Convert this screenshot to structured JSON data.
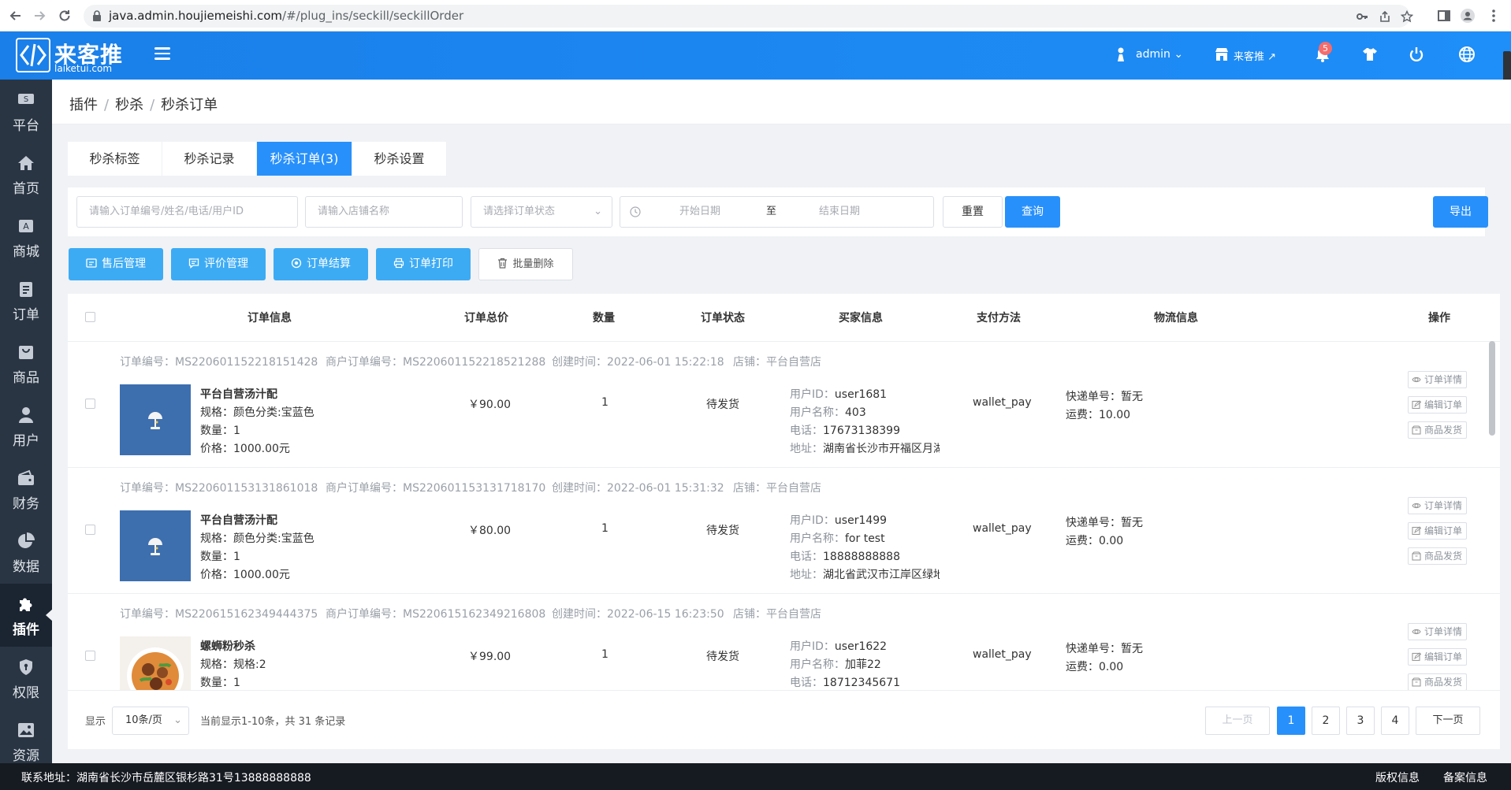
{
  "browser": {
    "url_host": "java.admin.houjiemeishi.com",
    "url_path": "/#/plug_ins/seckill/seckillOrder"
  },
  "header": {
    "logo_cn": "来客推",
    "logo_en": "laiketui.com",
    "user": "admin",
    "store_link": "来客推",
    "notification_count": "5"
  },
  "sidebar": {
    "items": [
      {
        "label": "平台",
        "icon": "platform-icon"
      },
      {
        "label": "首页",
        "icon": "home-icon"
      },
      {
        "label": "商城",
        "icon": "mall-icon"
      },
      {
        "label": "订单",
        "icon": "order-icon"
      },
      {
        "label": "商品",
        "icon": "goods-icon"
      },
      {
        "label": "用户",
        "icon": "user-icon"
      },
      {
        "label": "财务",
        "icon": "wallet-icon"
      },
      {
        "label": "数据",
        "icon": "pie-chart-icon"
      },
      {
        "label": "插件",
        "icon": "puzzle-icon",
        "active": true
      },
      {
        "label": "权限",
        "icon": "shield-icon"
      },
      {
        "label": "资源",
        "icon": "image-icon"
      }
    ]
  },
  "breadcrumb": {
    "items": [
      "插件",
      "秒杀",
      "秒杀订单"
    ]
  },
  "tabs": [
    {
      "label": "秒杀标签"
    },
    {
      "label": "秒杀记录"
    },
    {
      "label": "秒杀订单(3)",
      "active": true
    },
    {
      "label": "秒杀设置"
    }
  ],
  "filter": {
    "order_search_placeholder": "请输入订单编号/姓名/电话/用户ID",
    "store_placeholder": "请输入店铺名称",
    "status_placeholder": "请选择订单状态",
    "start_date_placeholder": "开始日期",
    "date_separator": "至",
    "end_date_placeholder": "结束日期",
    "reset_label": "重置",
    "query_label": "查询",
    "export_label": "导出"
  },
  "actions": {
    "after_sale": "售后管理",
    "reviews": "评价管理",
    "settlement": "订单结算",
    "print": "订单打印",
    "batch_delete": "批量删除"
  },
  "table": {
    "headers": {
      "order_info": "订单信息",
      "total": "订单总价",
      "quantity": "数量",
      "status": "订单状态",
      "buyer": "买家信息",
      "payment": "支付方法",
      "logistics": "物流信息",
      "operation": "操作"
    },
    "op_labels": {
      "detail": "订单详情",
      "edit": "编辑订单",
      "ship": "商品发货"
    },
    "orders": [
      {
        "order_no": "订单编号：MS220601152218151428",
        "merchant_no": "商户订单编号：MS220601152218521288",
        "created": "创建时间：2022-06-01 15:22:18",
        "store": "店铺：平台自营店",
        "product_name": "平台自营汤汁配",
        "spec": "规格：颜色分类:宝蓝色",
        "qty_line": "数量：1",
        "price_line": "价格：1000.00元",
        "total": "￥90.00",
        "quantity": "1",
        "status": "待发货",
        "buyer_id_label": "用户ID：",
        "buyer_id": "user1681",
        "buyer_name_label": "用户名称：",
        "buyer_name": "403",
        "buyer_phone_label": "电话：",
        "buyer_phone": "17673138399",
        "buyer_addr_label": "地址：",
        "buyer_addr": "湖南省长沙市开福区月湖",
        "payment": "wallet_pay",
        "express": "快递单号：暂无",
        "freight": "运费：10.00",
        "image": "product-icon-lamp"
      },
      {
        "order_no": "订单编号：MS220601153131861018",
        "merchant_no": "商户订单编号：MS220601153131718170",
        "created": "创建时间：2022-06-01 15:31:32",
        "store": "店铺：平台自营店",
        "product_name": "平台自营汤汁配",
        "spec": "规格：颜色分类:宝蓝色",
        "qty_line": "数量：1",
        "price_line": "价格：1000.00元",
        "total": "￥80.00",
        "quantity": "1",
        "status": "待发货",
        "buyer_id_label": "用户ID：",
        "buyer_id": "user1499",
        "buyer_name_label": "用户名称：",
        "buyer_name": "for test",
        "buyer_phone_label": "电话：",
        "buyer_phone": "18888888888",
        "buyer_addr_label": "地址：",
        "buyer_addr": "湖北省武汉市江岸区绿地",
        "payment": "wallet_pay",
        "express": "快递单号：暂无",
        "freight": "运费：0.00",
        "image": "product-icon-lamp"
      },
      {
        "order_no": "订单编号：MS220615162349444375",
        "merchant_no": "商户订单编号：MS220615162349216808",
        "created": "创建时间：2022-06-15 16:23:50",
        "store": "店铺：平台自营店",
        "product_name": "螺蛳粉秒杀",
        "spec": "规格：规格:2",
        "qty_line": "数量：1",
        "price_line": "",
        "total": "￥99.00",
        "quantity": "1",
        "status": "待发货",
        "buyer_id_label": "用户ID：",
        "buyer_id": "user1622",
        "buyer_name_label": "用户名称：",
        "buyer_name": "加菲22",
        "buyer_phone_label": "电话：",
        "buyer_phone": "18712345671",
        "buyer_addr_label": "",
        "buyer_addr": "",
        "payment": "wallet_pay",
        "express": "快递单号：暂无",
        "freight": "运费：0.00",
        "image": "product-photo-food"
      }
    ]
  },
  "pagination": {
    "show_label": "显示",
    "page_size": "10条/页",
    "summary": "当前显示1-10条，共 31 条记录",
    "prev": "上一页",
    "pages": [
      "1",
      "2",
      "3",
      "4"
    ],
    "current": "1",
    "next": "下一页"
  },
  "footer": {
    "address": "联系地址：湖南省长沙市岳麓区银杉路31号13888888888",
    "copyright": "版权信息",
    "icp": "备案信息"
  },
  "colors": {
    "primary": "#2890fb",
    "light_blue": "#3dabf4",
    "sidebar_bg": "#2a3543",
    "footer_bg": "#161a21",
    "badge": "#f56c6c"
  }
}
